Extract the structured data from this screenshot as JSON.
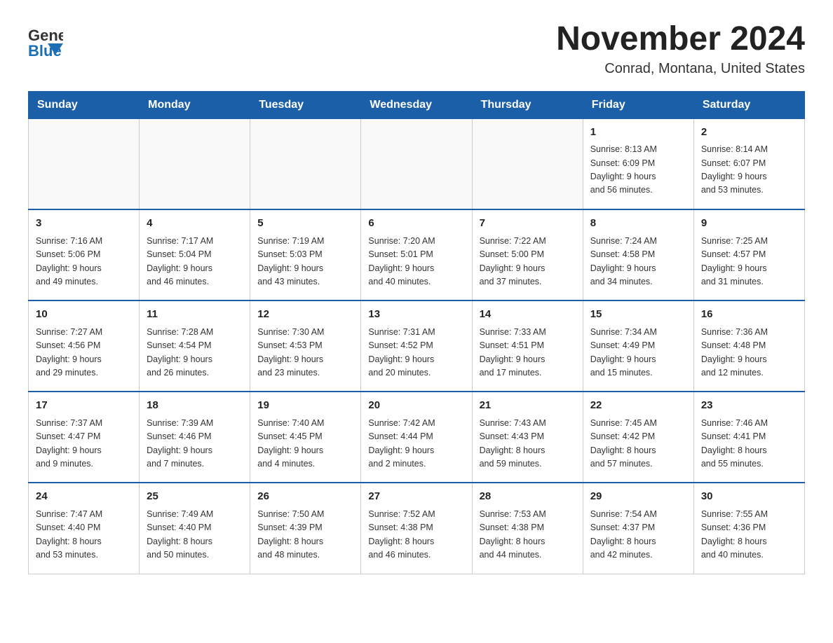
{
  "header": {
    "logo_general": "General",
    "logo_blue": "Blue",
    "month_title": "November 2024",
    "location": "Conrad, Montana, United States"
  },
  "weekdays": [
    "Sunday",
    "Monday",
    "Tuesday",
    "Wednesday",
    "Thursday",
    "Friday",
    "Saturday"
  ],
  "weeks": [
    [
      {
        "day": "",
        "info": ""
      },
      {
        "day": "",
        "info": ""
      },
      {
        "day": "",
        "info": ""
      },
      {
        "day": "",
        "info": ""
      },
      {
        "day": "",
        "info": ""
      },
      {
        "day": "1",
        "info": "Sunrise: 8:13 AM\nSunset: 6:09 PM\nDaylight: 9 hours\nand 56 minutes."
      },
      {
        "day": "2",
        "info": "Sunrise: 8:14 AM\nSunset: 6:07 PM\nDaylight: 9 hours\nand 53 minutes."
      }
    ],
    [
      {
        "day": "3",
        "info": "Sunrise: 7:16 AM\nSunset: 5:06 PM\nDaylight: 9 hours\nand 49 minutes."
      },
      {
        "day": "4",
        "info": "Sunrise: 7:17 AM\nSunset: 5:04 PM\nDaylight: 9 hours\nand 46 minutes."
      },
      {
        "day": "5",
        "info": "Sunrise: 7:19 AM\nSunset: 5:03 PM\nDaylight: 9 hours\nand 43 minutes."
      },
      {
        "day": "6",
        "info": "Sunrise: 7:20 AM\nSunset: 5:01 PM\nDaylight: 9 hours\nand 40 minutes."
      },
      {
        "day": "7",
        "info": "Sunrise: 7:22 AM\nSunset: 5:00 PM\nDaylight: 9 hours\nand 37 minutes."
      },
      {
        "day": "8",
        "info": "Sunrise: 7:24 AM\nSunset: 4:58 PM\nDaylight: 9 hours\nand 34 minutes."
      },
      {
        "day": "9",
        "info": "Sunrise: 7:25 AM\nSunset: 4:57 PM\nDaylight: 9 hours\nand 31 minutes."
      }
    ],
    [
      {
        "day": "10",
        "info": "Sunrise: 7:27 AM\nSunset: 4:56 PM\nDaylight: 9 hours\nand 29 minutes."
      },
      {
        "day": "11",
        "info": "Sunrise: 7:28 AM\nSunset: 4:54 PM\nDaylight: 9 hours\nand 26 minutes."
      },
      {
        "day": "12",
        "info": "Sunrise: 7:30 AM\nSunset: 4:53 PM\nDaylight: 9 hours\nand 23 minutes."
      },
      {
        "day": "13",
        "info": "Sunrise: 7:31 AM\nSunset: 4:52 PM\nDaylight: 9 hours\nand 20 minutes."
      },
      {
        "day": "14",
        "info": "Sunrise: 7:33 AM\nSunset: 4:51 PM\nDaylight: 9 hours\nand 17 minutes."
      },
      {
        "day": "15",
        "info": "Sunrise: 7:34 AM\nSunset: 4:49 PM\nDaylight: 9 hours\nand 15 minutes."
      },
      {
        "day": "16",
        "info": "Sunrise: 7:36 AM\nSunset: 4:48 PM\nDaylight: 9 hours\nand 12 minutes."
      }
    ],
    [
      {
        "day": "17",
        "info": "Sunrise: 7:37 AM\nSunset: 4:47 PM\nDaylight: 9 hours\nand 9 minutes."
      },
      {
        "day": "18",
        "info": "Sunrise: 7:39 AM\nSunset: 4:46 PM\nDaylight: 9 hours\nand 7 minutes."
      },
      {
        "day": "19",
        "info": "Sunrise: 7:40 AM\nSunset: 4:45 PM\nDaylight: 9 hours\nand 4 minutes."
      },
      {
        "day": "20",
        "info": "Sunrise: 7:42 AM\nSunset: 4:44 PM\nDaylight: 9 hours\nand 2 minutes."
      },
      {
        "day": "21",
        "info": "Sunrise: 7:43 AM\nSunset: 4:43 PM\nDaylight: 8 hours\nand 59 minutes."
      },
      {
        "day": "22",
        "info": "Sunrise: 7:45 AM\nSunset: 4:42 PM\nDaylight: 8 hours\nand 57 minutes."
      },
      {
        "day": "23",
        "info": "Sunrise: 7:46 AM\nSunset: 4:41 PM\nDaylight: 8 hours\nand 55 minutes."
      }
    ],
    [
      {
        "day": "24",
        "info": "Sunrise: 7:47 AM\nSunset: 4:40 PM\nDaylight: 8 hours\nand 53 minutes."
      },
      {
        "day": "25",
        "info": "Sunrise: 7:49 AM\nSunset: 4:40 PM\nDaylight: 8 hours\nand 50 minutes."
      },
      {
        "day": "26",
        "info": "Sunrise: 7:50 AM\nSunset: 4:39 PM\nDaylight: 8 hours\nand 48 minutes."
      },
      {
        "day": "27",
        "info": "Sunrise: 7:52 AM\nSunset: 4:38 PM\nDaylight: 8 hours\nand 46 minutes."
      },
      {
        "day": "28",
        "info": "Sunrise: 7:53 AM\nSunset: 4:38 PM\nDaylight: 8 hours\nand 44 minutes."
      },
      {
        "day": "29",
        "info": "Sunrise: 7:54 AM\nSunset: 4:37 PM\nDaylight: 8 hours\nand 42 minutes."
      },
      {
        "day": "30",
        "info": "Sunrise: 7:55 AM\nSunset: 4:36 PM\nDaylight: 8 hours\nand 40 minutes."
      }
    ]
  ]
}
